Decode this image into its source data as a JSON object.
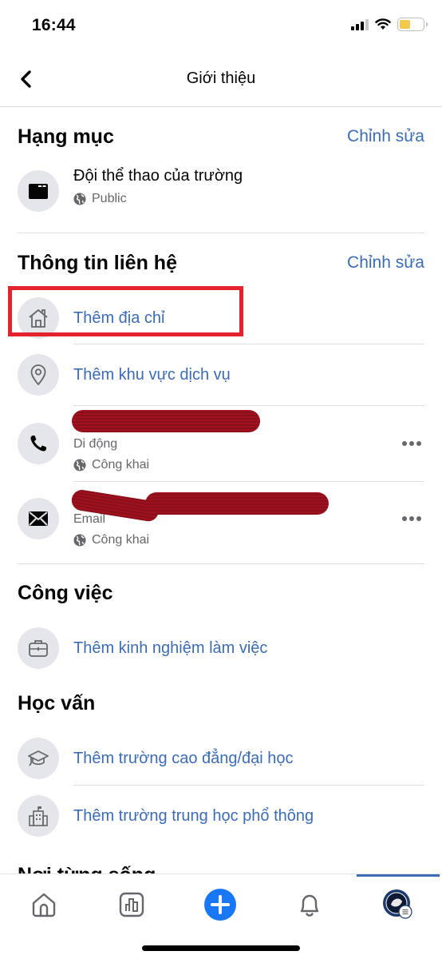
{
  "status_bar": {
    "time": "16:44",
    "battery_level": 0.45,
    "signal_bars_active": 3,
    "signal_bars_total": 4
  },
  "header": {
    "title": "Giới thiệu",
    "back_icon": "chevron-left-icon"
  },
  "sections": {
    "category": {
      "title": "Hạng mục",
      "edit_label": "Chỉnh sửa",
      "item": {
        "icon": "category-folder-icon",
        "label": "Đội thể thao của trường",
        "privacy": "Public",
        "privacy_icon": "globe-icon"
      }
    },
    "contact": {
      "title": "Thông tin liên hệ",
      "edit_label": "Chỉnh sửa",
      "add_address": {
        "icon": "home-icon",
        "label": "Thêm địa chỉ"
      },
      "add_service_area": {
        "icon": "location-pin-icon",
        "label": "Thêm khu vực dịch vụ"
      },
      "phone": {
        "icon": "phone-icon",
        "value": "",
        "type_label": "Di động",
        "privacy": "Công khai",
        "privacy_icon": "globe-icon"
      },
      "email": {
        "icon": "envelope-icon",
        "value": "",
        "type_label": "Email",
        "privacy": "Công khai",
        "privacy_icon": "globe-icon"
      }
    },
    "work": {
      "title": "Công việc",
      "add_work": {
        "icon": "briefcase-icon",
        "label": "Thêm kinh nghiệm làm việc"
      }
    },
    "education": {
      "title": "Học vấn",
      "add_college": {
        "icon": "graduation-cap-icon",
        "label": "Thêm trường cao đẳng/đại học"
      },
      "add_high_school": {
        "icon": "school-building-icon",
        "label": "Thêm trường trung học phổ thông"
      }
    },
    "places_lived": {
      "title": "Nơi từng sống"
    }
  },
  "bottom_nav": {
    "items": [
      {
        "name": "home",
        "icon": "home-outline-icon"
      },
      {
        "name": "insights",
        "icon": "bar-chart-icon"
      },
      {
        "name": "create",
        "icon": "plus-circle-icon"
      },
      {
        "name": "notifications",
        "icon": "bell-icon"
      },
      {
        "name": "profile-menu",
        "icon": "profile-avatar-icon",
        "active": true
      }
    ]
  },
  "colors": {
    "link": "#3b6cb4",
    "accent": "#1877f2",
    "icon_bg": "#e4e6eb",
    "highlight": "#e3222c",
    "redaction": "#8b0f1a"
  }
}
